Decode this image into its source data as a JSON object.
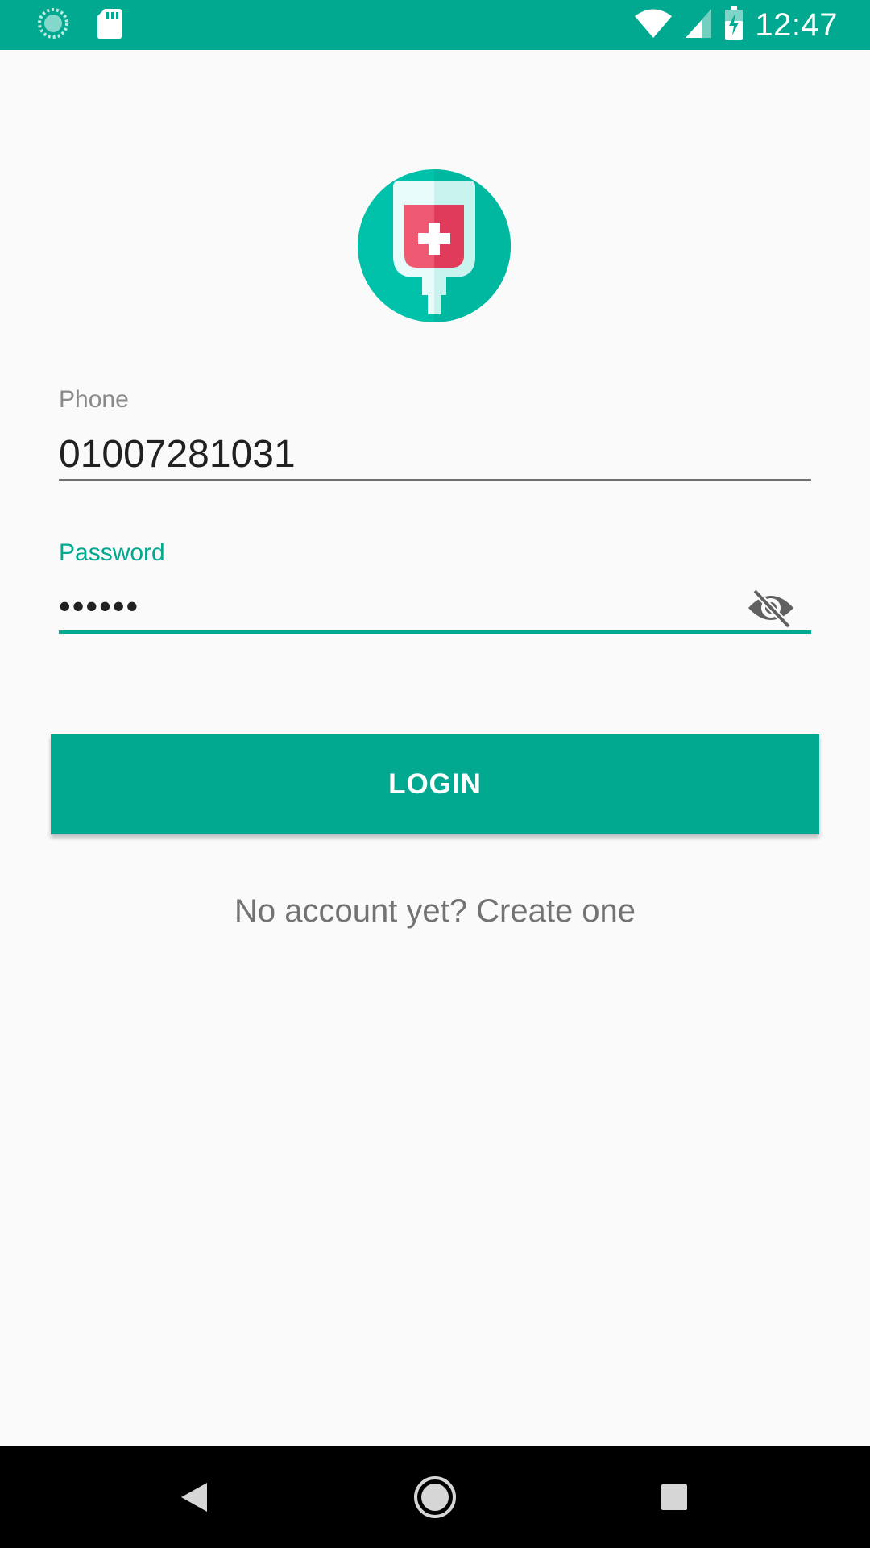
{
  "status_bar": {
    "time": "12:47",
    "icons": [
      "sync-icon",
      "sd-card-icon",
      "wifi-icon",
      "signal-icon",
      "battery-charging-icon"
    ]
  },
  "logo": {
    "icon": "blood-bag-icon"
  },
  "phone": {
    "label": "Phone",
    "value": "01007281031"
  },
  "password": {
    "label": "Password",
    "value": "••••••",
    "toggle_icon": "visibility-off-icon"
  },
  "login": {
    "label": "LOGIN"
  },
  "create_account": {
    "text": "No account yet? Create one"
  },
  "nav_bar": {
    "icons": [
      "back-icon",
      "home-icon",
      "recents-icon"
    ]
  },
  "colors": {
    "primary": "#00a98f",
    "background": "#fafafa",
    "text_dark": "#212121",
    "text_muted": "#737373",
    "blood_red": "#e63d5c"
  }
}
